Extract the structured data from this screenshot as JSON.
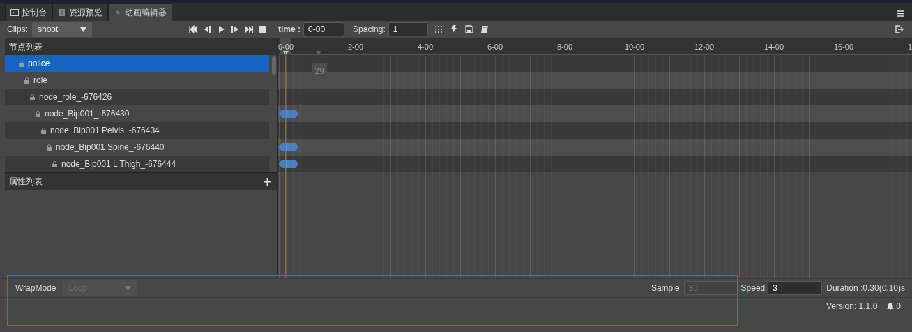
{
  "tabs": [
    {
      "label": "控制台",
      "selected": false
    },
    {
      "label": "资源预览",
      "selected": false
    },
    {
      "label": "动画编辑器",
      "selected": true
    }
  ],
  "toolbar": {
    "clips_label": "Clips:",
    "clip": "shoot",
    "time_label": "time :",
    "time": "0-00",
    "spacing_label": "Spacing:",
    "spacing": "1"
  },
  "node_panel": {
    "title": "节点列表",
    "nodes": [
      {
        "name": "police",
        "selected": true,
        "keyframe": false,
        "children": [
          {
            "name": "role",
            "selected": false,
            "keyframe": false,
            "children": [
              {
                "name": "node_role_-676426",
                "selected": false,
                "keyframe": false,
                "children": [
                  {
                    "name": "node_Bip001_-676430",
                    "selected": false,
                    "keyframe": true,
                    "children": [
                      {
                        "name": "node_Bip001 Pelvis_-676434",
                        "selected": false,
                        "keyframe": false,
                        "children": [
                          {
                            "name": "node_Bip001 Spine_-676440",
                            "selected": false,
                            "keyframe": true,
                            "children": [
                              {
                                "name": "node_Bip001 L Thigh_-676444",
                                "selected": false,
                                "keyframe": true
                              }
                            ]
                          }
                        ]
                      }
                    ]
                  }
                ]
              }
            ]
          }
        ]
      }
    ]
  },
  "property_panel": {
    "title": "属性列表"
  },
  "timeline": {
    "ruler_labels": [
      "0-00",
      "2-00",
      "4-00",
      "6-00",
      "8-00",
      "10-00",
      "12-00",
      "14-00",
      "16-00",
      "1"
    ],
    "marker_label": "29"
  },
  "footer": {
    "wrapmode_label": "WrapMode",
    "wrapmode": "Loop",
    "wrapmode_disabled": true,
    "sample_label": "Sample",
    "sample": "30",
    "sample_disabled": true,
    "speed_label": "Speed",
    "speed": "3",
    "duration": "Duration :0.30(0.10)s"
  },
  "status_bar": {
    "version": "Version: 1.1.0",
    "notifications": "0"
  }
}
